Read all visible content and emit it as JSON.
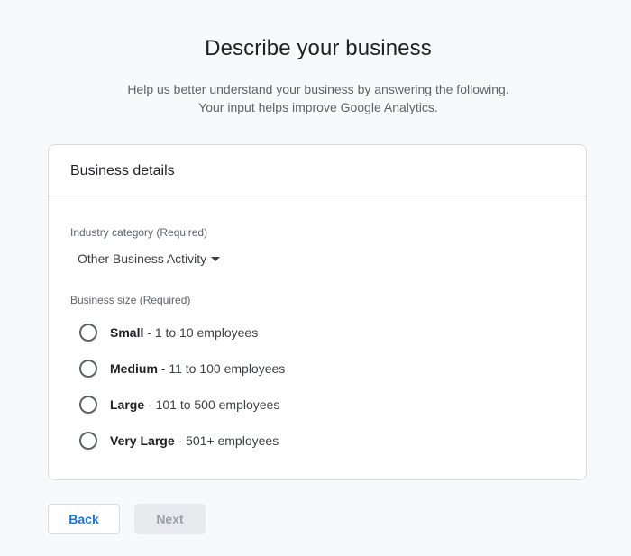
{
  "header": {
    "title": "Describe your business",
    "subtitle_line1": "Help us better understand your business by answering the following.",
    "subtitle_line2": "Your input helps improve Google Analytics."
  },
  "card": {
    "title": "Business details",
    "industry": {
      "label": "Industry category (Required)",
      "selected": "Other Business Activity"
    },
    "size": {
      "label": "Business size (Required)",
      "options": [
        {
          "name": "Small",
          "detail": "1 to 10 employees"
        },
        {
          "name": "Medium",
          "detail": "11 to 100 employees"
        },
        {
          "name": "Large",
          "detail": "101 to 500 employees"
        },
        {
          "name": "Very Large",
          "detail": "501+ employees"
        }
      ]
    }
  },
  "footer": {
    "back_label": "Back",
    "next_label": "Next"
  },
  "colors": {
    "accent": "#1a73e8",
    "disabled_bg": "#e8eaed",
    "disabled_text": "#9aa0a6"
  }
}
